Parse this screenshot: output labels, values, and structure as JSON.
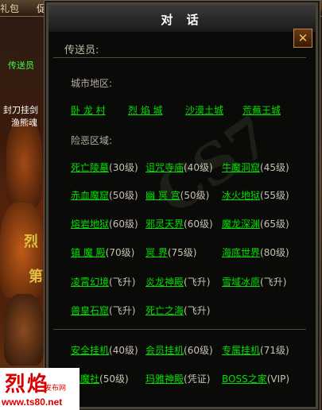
{
  "world": {
    "topbar": [
      "礼包",
      "促销商城",
      "福"
    ],
    "right_top_badge": "石",
    "labels": [
      {
        "text": "传送员",
        "color": "#40ff40"
      },
      {
        "text": "封刀挂剑",
        "color": "#ffffff"
      },
      {
        "text": "渔熊魂",
        "color": "#ffffff"
      },
      {
        "text": "烈",
        "color": "#e0c040"
      },
      {
        "text": "第",
        "color": "#e0c040"
      }
    ]
  },
  "dialog": {
    "title": "对 话",
    "close_label": "✕",
    "npc_name": "传送员:",
    "city_section": {
      "label": "城市地区:",
      "links": [
        "卧 龙 村",
        "烈 焰 城",
        "沙漠土城",
        "荒蕪王城"
      ]
    },
    "danger_section": {
      "label": "险恶区域:",
      "rows": [
        [
          {
            "name": "死亡陵墓",
            "level": "(30级)"
          },
          {
            "name": "诅咒寺庙",
            "level": "(40级)"
          },
          {
            "name": "牛魔洞窟",
            "level": "(45级)"
          }
        ],
        [
          {
            "name": "赤血魔窟",
            "level": "(50级)"
          },
          {
            "name": "幽 冥 宫",
            "level": "(50级)"
          },
          {
            "name": "冰火地狱",
            "level": "(55级)"
          }
        ],
        [
          {
            "name": "熔岩地狱",
            "level": "(60级)"
          },
          {
            "name": "邪灵天界",
            "level": "(60级)"
          },
          {
            "name": "魔龙深渊",
            "level": "(65级)"
          }
        ],
        [
          {
            "name": "镇 魔 殿",
            "level": "(70级)"
          },
          {
            "name": "冥   界",
            "level": "(75级)"
          },
          {
            "name": "海底世界",
            "level": "(80级)"
          }
        ],
        [
          {
            "name": "凌霄幻境",
            "level": "(飞升)"
          },
          {
            "name": "炎龙神殿",
            "level": "(飞升)"
          },
          {
            "name": "雪域冰原",
            "level": "(飞升)"
          }
        ],
        [
          {
            "name": "兽皇石窟",
            "level": "(飞升)"
          },
          {
            "name": "死亡之海",
            "level": "(飞升)"
          }
        ]
      ]
    },
    "afk_section": {
      "rows": [
        [
          {
            "name": "安全挂机",
            "level": "(40级)"
          },
          {
            "name": "会员挂机",
            "level": "(60级)"
          },
          {
            "name": "专属挂机",
            "level": "(71级)"
          }
        ],
        [
          {
            "name": "威魔社",
            "level": "(50级)"
          },
          {
            "name": "玛雅神殿",
            "level": "(凭证)"
          },
          {
            "name": "BOSS之家",
            "level": "(VIP)"
          }
        ]
      ]
    },
    "watermark": "CS7"
  },
  "site_logo": {
    "brand": "烈焰",
    "sub": "发布网",
    "url": "www.ts80.net"
  },
  "colors": {
    "link": "#00e000",
    "level": "#c8c0b0",
    "dialog_bg": "#0a0a08",
    "logo_red": "#d80000"
  }
}
